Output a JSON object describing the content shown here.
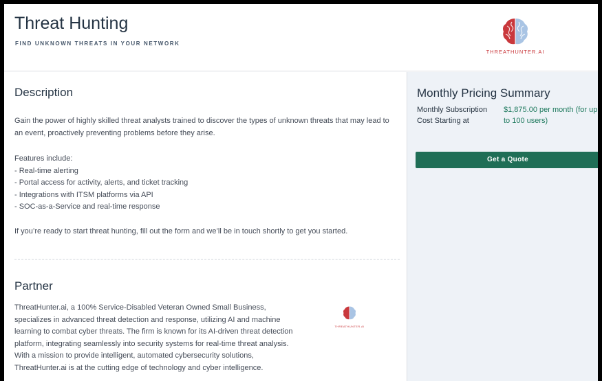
{
  "header": {
    "title": "Threat Hunting",
    "subtitle": "FIND UNKNOWN THREATS IN YOUR NETWORK",
    "logo_text_main": "THREATHUNTER",
    "logo_text_ai": ".AI"
  },
  "description": {
    "heading": "Description",
    "intro": "Gain the power of highly skilled threat analysts trained to discover the types of unknown threats that may lead to an event, proactively preventing problems before they arise.",
    "features_heading": "Features include:",
    "features": [
      "- Real-time alerting",
      "- Portal access for activity, alerts, and ticket tracking",
      "- Integrations with ITSM platforms via API",
      "- SOC-as-a-Service and real-time response"
    ],
    "cta": "If you’re ready to start threat hunting, fill out the form and we’ll be in touch shortly to get you started."
  },
  "partner": {
    "heading": "Partner",
    "text": "ThreatHunter.ai, a 100% Service-Disabled Veteran Owned Small Business, specializes in advanced threat detection and response, utilizing AI and machine learning to combat cyber threats. The firm is known for its AI-driven threat detection platform, integrating seamlessly into security systems for real-time threat analysis. With a mission to provide intelligent, automated cybersecurity solutions, ThreatHunter.ai is at the cutting edge of technology and cyber intelligence.",
    "logo_text": "THREATHUNTER.AI"
  },
  "pricing": {
    "heading": "Monthly Pricing Summary",
    "label": "Monthly Subscription Cost Starting at",
    "value": "$1,875.00 per month (for up to 100 users)",
    "button_label": "Get a Quote"
  },
  "colors": {
    "accent_green": "#1f6e56",
    "price_green": "#1f7a5e",
    "brand_red": "#c9383c",
    "brand_blue": "#8fb3d9"
  }
}
